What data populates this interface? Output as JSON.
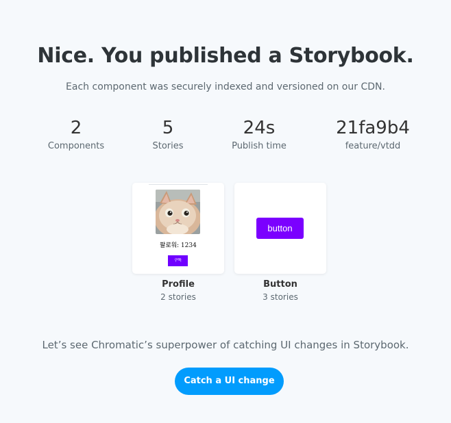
{
  "header": {
    "title": "Nice. You published a Storybook.",
    "subtitle": "Each component was securely indexed and versioned on our CDN."
  },
  "stats": [
    {
      "value": "2",
      "label": "Components"
    },
    {
      "value": "5",
      "label": "Stories"
    },
    {
      "value": "24s",
      "label": "Publish time"
    },
    {
      "value": "21fa9b4",
      "label": "feature/vtdd"
    }
  ],
  "components": [
    {
      "name": "Profile",
      "stories": "2 stories",
      "preview": {
        "image": "cat-photo",
        "follower_text": "팔로워: 1234",
        "follow_button_label": "구독"
      }
    },
    {
      "name": "Button",
      "stories": "3 stories",
      "preview": {
        "button_label": "button"
      }
    }
  ],
  "footer": {
    "prompt": "Let’s see Chromatic’s superpower of catching UI changes in Storybook.",
    "cta_label": "Catch a UI change"
  },
  "colors": {
    "background": "#f6f9fc",
    "cta": "#029cfd",
    "preview_button": "#7b00ff"
  }
}
